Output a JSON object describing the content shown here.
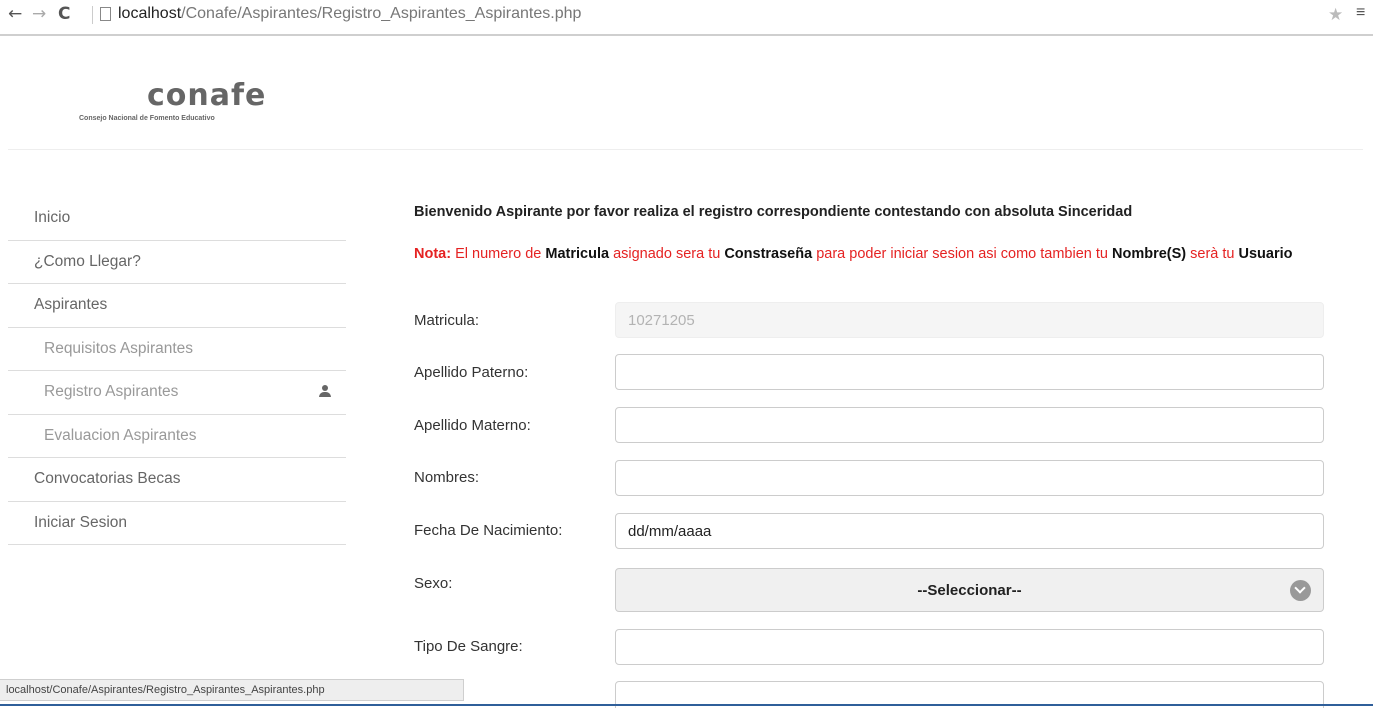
{
  "browser": {
    "url_host": "localhost",
    "url_path": "/Conafe/Aspirantes/Registro_Aspirantes_Aspirantes.php",
    "status_url": "localhost/Conafe/Aspirantes/Registro_Aspirantes_Aspirantes.php"
  },
  "logo": {
    "mark": "conafe",
    "tagline": "Consejo Nacional de Fomento Educativo"
  },
  "sidebar": {
    "items": [
      {
        "label": "Inicio"
      },
      {
        "label": "¿Como Llegar?"
      },
      {
        "label": "Aspirantes"
      },
      {
        "label": "Requisitos Aspirantes"
      },
      {
        "label": "Registro Aspirantes",
        "icon": "user-icon"
      },
      {
        "label": "Evaluacion Aspirantes"
      },
      {
        "label": "Convocatorias Becas"
      },
      {
        "label": "Iniciar Sesion"
      }
    ]
  },
  "main": {
    "welcome": "Bienvenido Aspirante por favor realiza el registro correspondiente contestando con absoluta Sinceridad",
    "note": {
      "prefix": "Nota:",
      "t1": " El numero de ",
      "b1": "Matricula",
      "t2": " asignado sera tu ",
      "b2": "Constraseña",
      "t3": " para poder iniciar sesion asi como tambien tu ",
      "b3": "Nombre(S)",
      "t4": " serà tu ",
      "b4": "Usuario"
    }
  },
  "form": {
    "matricula": {
      "label": "Matricula:",
      "value": "10271205"
    },
    "apellido_paterno": {
      "label": "Apellido Paterno:",
      "value": ""
    },
    "apellido_materno": {
      "label": "Apellido Materno:",
      "value": ""
    },
    "nombres": {
      "label": "Nombres:",
      "value": ""
    },
    "fecha_nacimiento": {
      "label": "Fecha De Nacimiento:",
      "value": "dd/mm/aaaa"
    },
    "sexo": {
      "label": "Sexo:",
      "selected": "--Seleccionar--"
    },
    "tipo_sangre": {
      "label": "Tipo De Sangre:",
      "value": ""
    }
  },
  "colors": {
    "note_red": "#e52222",
    "status_bar": "#eeeeee",
    "bottom_bar": "#2f5f9a"
  }
}
